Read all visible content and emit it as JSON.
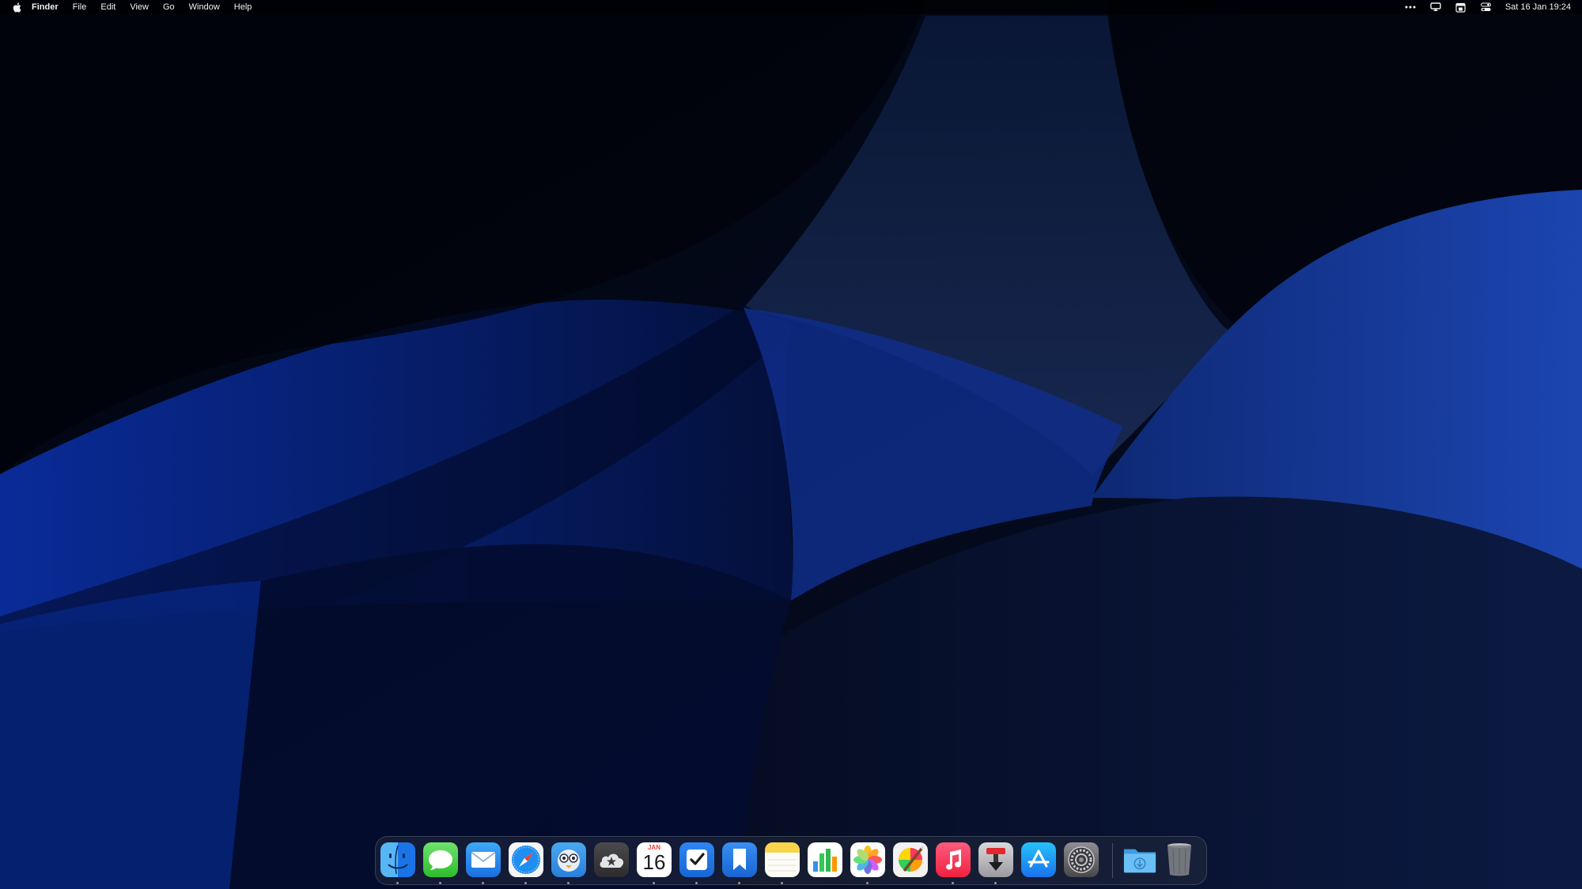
{
  "menubar": {
    "apple_icon": "apple-logo-icon",
    "app_name": "Finder",
    "menus": [
      "File",
      "Edit",
      "View",
      "Go",
      "Window",
      "Help"
    ],
    "status_icons": [
      "more-dots-icon",
      "screen-mirroring-icon",
      "calendar-widget-icon",
      "control-center-icon"
    ],
    "clock": "Sat 16 Jan  19:24"
  },
  "dock": {
    "apps": [
      {
        "name": "finder",
        "icon": "finder-icon",
        "running": true
      },
      {
        "name": "messages",
        "icon": "messages-icon",
        "running": true
      },
      {
        "name": "mail",
        "icon": "mail-icon",
        "running": true
      },
      {
        "name": "safari",
        "icon": "safari-icon",
        "running": true
      },
      {
        "name": "tweetbot",
        "icon": "tweetbot-icon",
        "running": true
      },
      {
        "name": "reeder",
        "icon": "reeder-icon",
        "running": false
      },
      {
        "name": "calendar",
        "icon": "calendar-icon",
        "running": true,
        "month": "JAN",
        "day": "16"
      },
      {
        "name": "things",
        "icon": "things-icon",
        "running": true
      },
      {
        "name": "bookmarks",
        "icon": "bookmarks-icon",
        "running": true
      },
      {
        "name": "notes",
        "icon": "notes-icon",
        "running": true
      },
      {
        "name": "numbers",
        "icon": "numbers-icon",
        "running": false
      },
      {
        "name": "photos",
        "icon": "photos-icon",
        "running": true
      },
      {
        "name": "pixelmator",
        "icon": "pixelmator-icon",
        "running": false
      },
      {
        "name": "music",
        "icon": "music-icon",
        "running": true
      },
      {
        "name": "transmit",
        "icon": "transmit-icon",
        "running": true
      },
      {
        "name": "app-store",
        "icon": "app-store-icon",
        "running": false
      },
      {
        "name": "system-preferences",
        "icon": "system-preferences-icon",
        "running": false
      }
    ],
    "stacks": [
      {
        "name": "downloads",
        "icon": "downloads-folder-icon"
      },
      {
        "name": "trash",
        "icon": "trash-icon"
      }
    ]
  },
  "colors": {
    "wallpaper_base": "#01040d",
    "wallpaper_blue": "#0a2a8c",
    "accent_blue": "#1a74e8"
  }
}
